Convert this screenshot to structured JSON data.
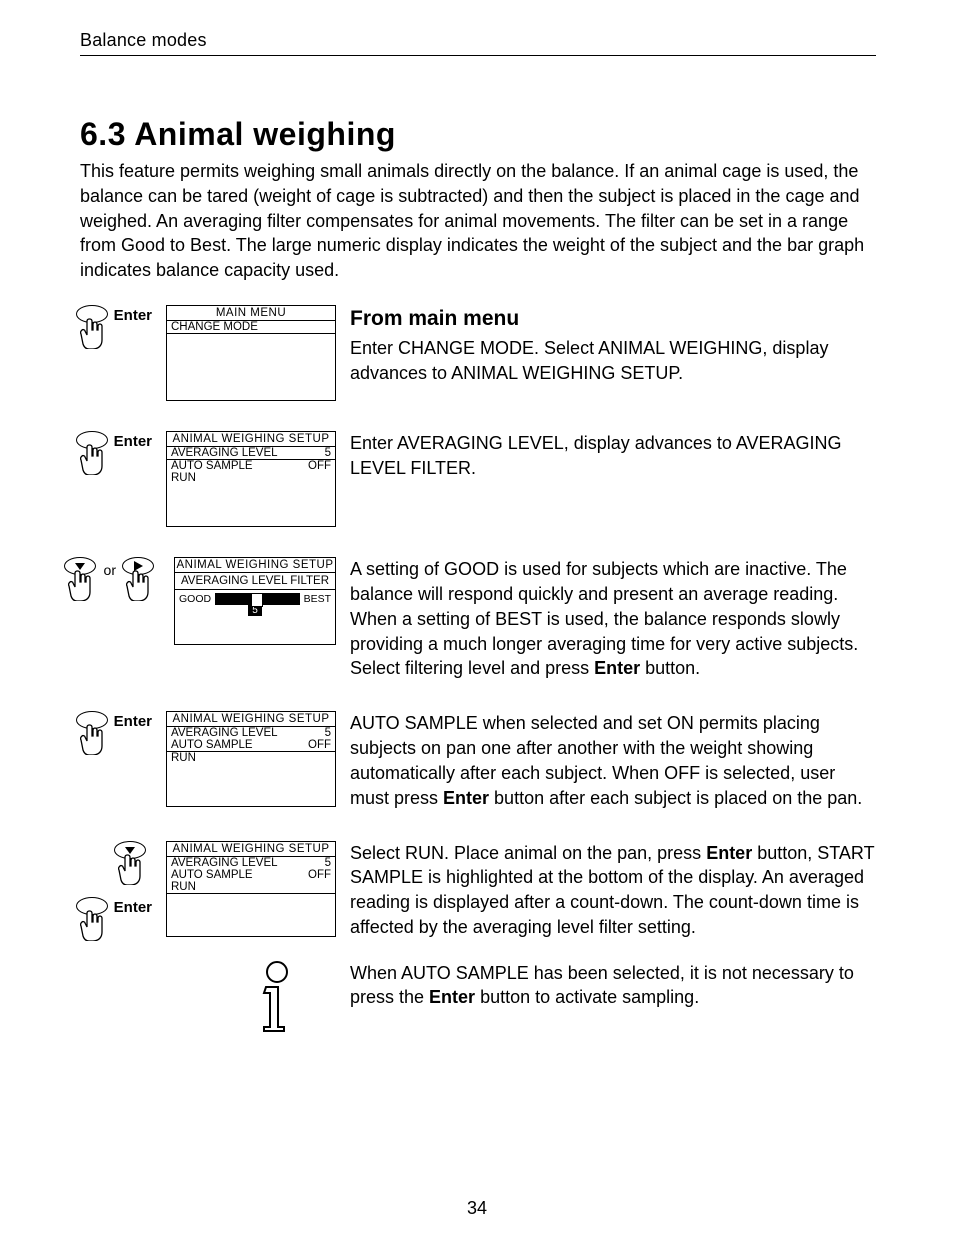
{
  "header": {
    "running_head": "Balance modes"
  },
  "section": {
    "number_title": "6.3  Animal weighing",
    "intro": "This feature permits weighing small animals directly on the balance.  If an animal cage is used, the balance can be tared (weight of cage is subtracted) and then the subject is placed in the cage and weighed.  An averaging filter compensates for animal movements.  The filter can be set in a range from Good to Best.  The large numeric display indicates the weight of the subject and the bar graph indicates balance capacity used."
  },
  "labels": {
    "enter": "Enter",
    "or": "or"
  },
  "steps": {
    "s1": {
      "screen": {
        "title": "MAIN MENU",
        "line1": "CHANGE MODE"
      },
      "heading": "From main menu",
      "text": "Enter CHANGE MODE.  Select ANIMAL WEIGHING, display advances to ANIMAL WEIGHING SETUP."
    },
    "s2": {
      "screen": {
        "title": "ANIMAL  WEIGHING    SETUP",
        "r1a": "AVERAGING  LEVEL",
        "r1b": "5",
        "r2a": "AUTO  SAMPLE",
        "r2b": "OFF",
        "r3": "RUN"
      },
      "text": "Enter AVERAGING LEVEL, display advances to AVERAGING LEVEL FILTER."
    },
    "s3": {
      "screen": {
        "title": "ANIMAL  WEIGHING  SETUP",
        "filter_label": "AVERAGING  LEVEL  FILTER",
        "left": "GOOD",
        "right": "BEST",
        "value": "5"
      },
      "text_a": "A setting of GOOD is used for subjects which are inactive.  The balance will respond quickly and present an average reading.  When a setting of BEST is used, the balance responds slowly providing a much longer averaging time for very active subjects. Select filtering level and press ",
      "text_b": " button."
    },
    "s4": {
      "screen": {
        "title": "ANIMAL  WEIGHING    SETUP",
        "r1a": "AVERAGING  LEVEL",
        "r1b": "5",
        "r2a": "AUTO  SAMPLE",
        "r2b": "OFF",
        "r3": "RUN"
      },
      "text_a": "AUTO SAMPLE when selected and set ON permits placing subjects on pan one after another with the weight showing automatically after each subject.  When OFF is selected, user must press ",
      "text_b": " button after each subject is placed on the pan."
    },
    "s5": {
      "screen": {
        "title": "ANIMAL  WEIGHING    SETUP",
        "r1a": "AVERAGING LEVEL",
        "r1b": "5",
        "r2a": "AUTO SAMPLE",
        "r2b": "OFF",
        "r3": "RUN"
      },
      "text_a": "Select RUN.  Place animal on the pan, press ",
      "text_b": " button, START SAMPLE is highlighted at the bottom of the display.  An averaged reading is displayed after a count-down.  The count-down time is affected by the averaging level filter setting."
    },
    "s6": {
      "text_a": "When AUTO SAMPLE has been selected, it is not necessary to press the ",
      "text_b": " button to activate sampling."
    }
  },
  "footer": {
    "page_number": "34"
  }
}
